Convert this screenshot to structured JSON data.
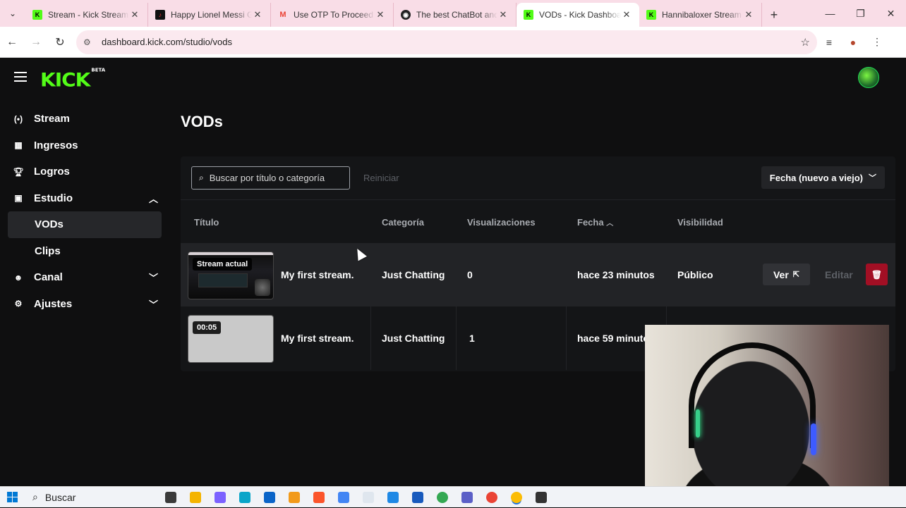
{
  "browser": {
    "tabs": [
      {
        "title": "Stream - Kick Stream",
        "favicon": "kick-icon",
        "color": "#53fc18",
        "active": false
      },
      {
        "title": "Happy Lionel Messi G",
        "favicon": "tiktok-icon",
        "color": "#111111",
        "active": false
      },
      {
        "title": "Use OTP To Proceed",
        "favicon": "gmail-icon",
        "color": "#ea4335",
        "active": false
      },
      {
        "title": "The best ChatBot and",
        "favicon": "chatbot-icon",
        "color": "#222222",
        "active": false
      },
      {
        "title": "VODs - Kick Dashboa",
        "favicon": "kick-icon",
        "color": "#53fc18",
        "active": true
      },
      {
        "title": "Hannibaloxer Stream",
        "favicon": "kick-icon",
        "color": "#53fc18",
        "active": false
      }
    ],
    "url": "dashboard.kick.com/studio/vods"
  },
  "app": {
    "logo": "KICK",
    "logo_tag": "BETA",
    "brand_color": "#53fc18"
  },
  "sidebar": {
    "items": [
      {
        "label": "Stream",
        "icon": "broadcast-icon"
      },
      {
        "label": "Ingresos",
        "icon": "chart-bars-icon"
      },
      {
        "label": "Logros",
        "icon": "trophy-icon"
      },
      {
        "label": "Estudio",
        "icon": "studio-icon"
      },
      {
        "label": "Canal",
        "icon": "channel-icon"
      },
      {
        "label": "Ajustes",
        "icon": "gear-icon"
      }
    ],
    "studio_children": [
      "VODs",
      "Clips"
    ]
  },
  "page": {
    "title": "VODs",
    "search_placeholder": "Buscar por título o categoría",
    "reset_label": "Reiniciar",
    "sort_label": "Fecha (nuevo a viejo)"
  },
  "table": {
    "headers": {
      "title": "Título",
      "category": "Categoría",
      "views": "Visualizaciones",
      "date": "Fecha",
      "visibility": "Visibilidad"
    },
    "rows": [
      {
        "badge": "Stream actual",
        "title": "My first stream.",
        "category": "Just Chatting",
        "views": "0",
        "date": "hace 23 minutos",
        "visibility": "Público"
      },
      {
        "badge": "00:05",
        "title": "My first stream.",
        "category": "Just Chatting",
        "views": "1",
        "date": "hace 59 minuto",
        "visibility": ""
      }
    ],
    "actions": {
      "view": "Ver",
      "edit": "Editar"
    }
  },
  "taskbar": {
    "search_label": "Buscar",
    "apps": [
      {
        "name": "task-view-icon",
        "color": "#3a3a3a"
      },
      {
        "name": "file-explorer-icon",
        "color": "#f4b400"
      },
      {
        "name": "copilot-icon",
        "color": "#7b61ff"
      },
      {
        "name": "edge-icon",
        "color": "#0aa5c9"
      },
      {
        "name": "outlook-icon",
        "color": "#0a64c8"
      },
      {
        "name": "sublime-icon",
        "color": "#f29a1a"
      },
      {
        "name": "brave-icon",
        "color": "#fb542b"
      },
      {
        "name": "store-icon",
        "color": "#4285f4"
      },
      {
        "name": "notepad-icon",
        "color": "#dfe6ee"
      },
      {
        "name": "vscode-icon",
        "color": "#1e88e5"
      },
      {
        "name": "word-icon",
        "color": "#185abd"
      },
      {
        "name": "chrome-icon",
        "color": "#34a853"
      },
      {
        "name": "teams-icon",
        "color": "#5b5fc7"
      },
      {
        "name": "chrome-icon",
        "color": "#ea4335"
      },
      {
        "name": "chrome-icon",
        "color": "#fbbc05"
      },
      {
        "name": "obs-icon",
        "color": "#333333"
      }
    ]
  }
}
